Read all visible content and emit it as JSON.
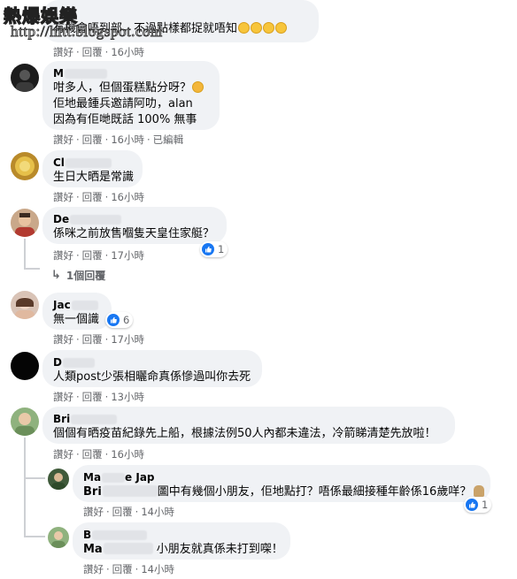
{
  "watermark": {
    "title": "熱爆娛樂",
    "url": "http://hitt.blogspot.com"
  },
  "actions": {
    "like": "讚好",
    "reply": "回覆",
    "edited": "已編輯"
  },
  "comments": [
    {
      "name": "",
      "text": "有機會唔到部，不過點樣都捉就唔知",
      "time": "16小時",
      "emoji_count": 4
    },
    {
      "name": "M",
      "lines": [
        "咁多人，但個蛋糕點分呀？",
        "佢地最鍾兵邀請阿叻，alan",
        "因為有佢哋既話 100% 無事"
      ],
      "time": "16小時",
      "edited": true
    },
    {
      "name": "Cl",
      "text": "生日大晒是常識",
      "time": "16小時"
    },
    {
      "name": "De",
      "text": "係咪之前放售嗰隻天皇住家艇？",
      "time": "17小時",
      "reactions": "1",
      "replies_link": "1個回覆"
    },
    {
      "name": "Jac",
      "text": "無一個識",
      "time": "17小時",
      "reactions": "6"
    },
    {
      "name": "D",
      "text": "人類post少張相曬命真係慘過叫你去死",
      "time": "13小時"
    },
    {
      "name": "Bri",
      "text": "個個有晒疫苗紀錄先上船，根據法例50人內都未違法，冷箭睇清楚先放啦！",
      "time": "16小時"
    }
  ],
  "replies": [
    {
      "name": "Ma",
      "name_suffix": "e Jap",
      "text_prefix": "Bri",
      "text": "圖中有幾個小朋友，佢地點打？唔係最細接種年齡係16歲咩？",
      "time": "14小時",
      "reactions": "1"
    },
    {
      "name": "B",
      "text_prefix": "Ma",
      "text": "小朋友就真係未打到㗎！",
      "time": "14小時"
    }
  ],
  "colors": {
    "bubble": "#f0f2f5",
    "secondary_text": "#65676b",
    "like_blue": "#1877f2"
  }
}
